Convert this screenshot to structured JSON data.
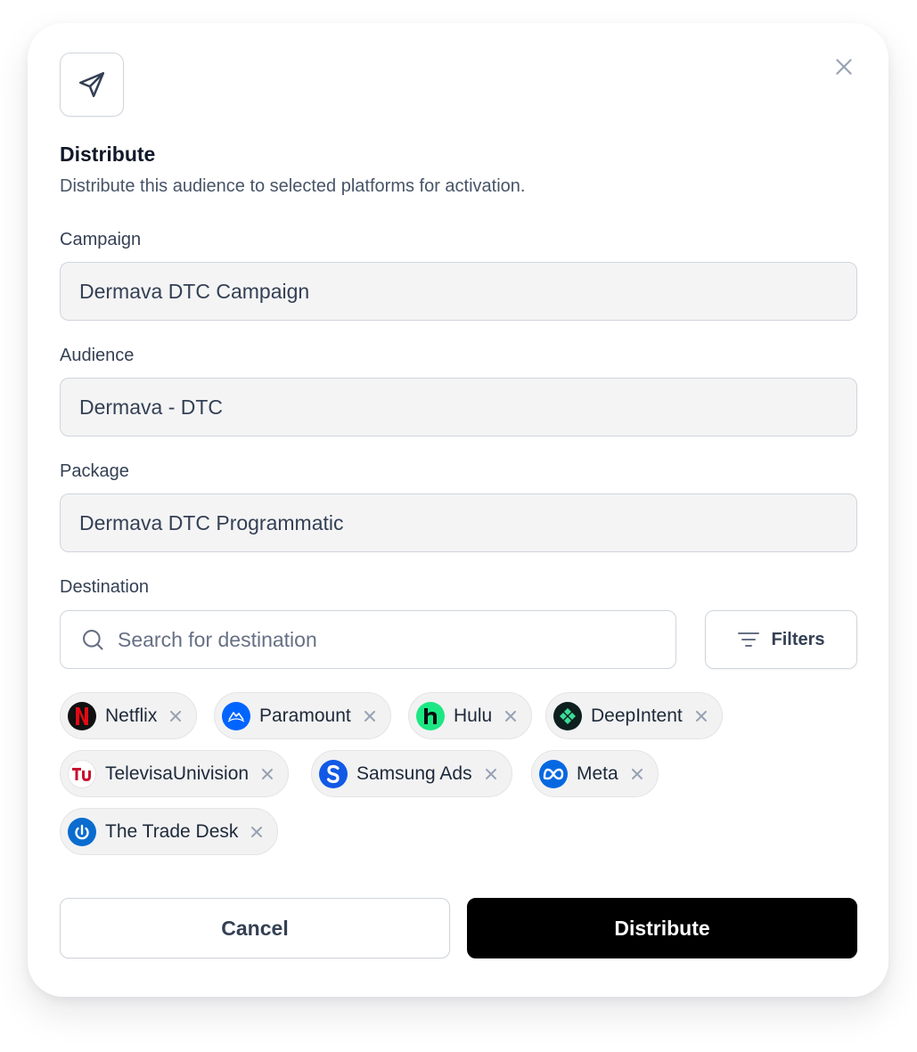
{
  "dialog": {
    "title": "Distribute",
    "subtitle": "Distribute this audience to selected platforms for activation."
  },
  "fields": {
    "campaign": {
      "label": "Campaign",
      "value": "Dermava DTC Campaign"
    },
    "audience": {
      "label": "Audience",
      "value": "Dermava - DTC"
    },
    "package": {
      "label": "Package",
      "value": "Dermava DTC Programmatic"
    }
  },
  "destination": {
    "label": "Destination",
    "search_placeholder": "Search for destination",
    "filters_label": "Filters",
    "chips": [
      {
        "label": "Netflix",
        "icon": "netflix-logo-icon",
        "color": "#111111"
      },
      {
        "label": "Paramount",
        "icon": "paramount-logo-icon",
        "color": "#0064ff"
      },
      {
        "label": "Hulu",
        "icon": "hulu-logo-icon",
        "color": "#1ce783"
      },
      {
        "label": "DeepIntent",
        "icon": "deepintent-logo-icon",
        "color": "#0d1f1f"
      },
      {
        "label": "TelevisaUnivision",
        "icon": "televisaunivision-logo-icon",
        "color": "#c8102e"
      },
      {
        "label": "Samsung Ads",
        "icon": "samsung-ads-logo-icon",
        "color": "#1259e6"
      },
      {
        "label": "Meta",
        "icon": "meta-logo-icon",
        "color": "#0668e1"
      },
      {
        "label": "The Trade Desk",
        "icon": "trade-desk-logo-icon",
        "color": "#0a6ccf"
      }
    ]
  },
  "actions": {
    "cancel_label": "Cancel",
    "submit_label": "Distribute"
  }
}
